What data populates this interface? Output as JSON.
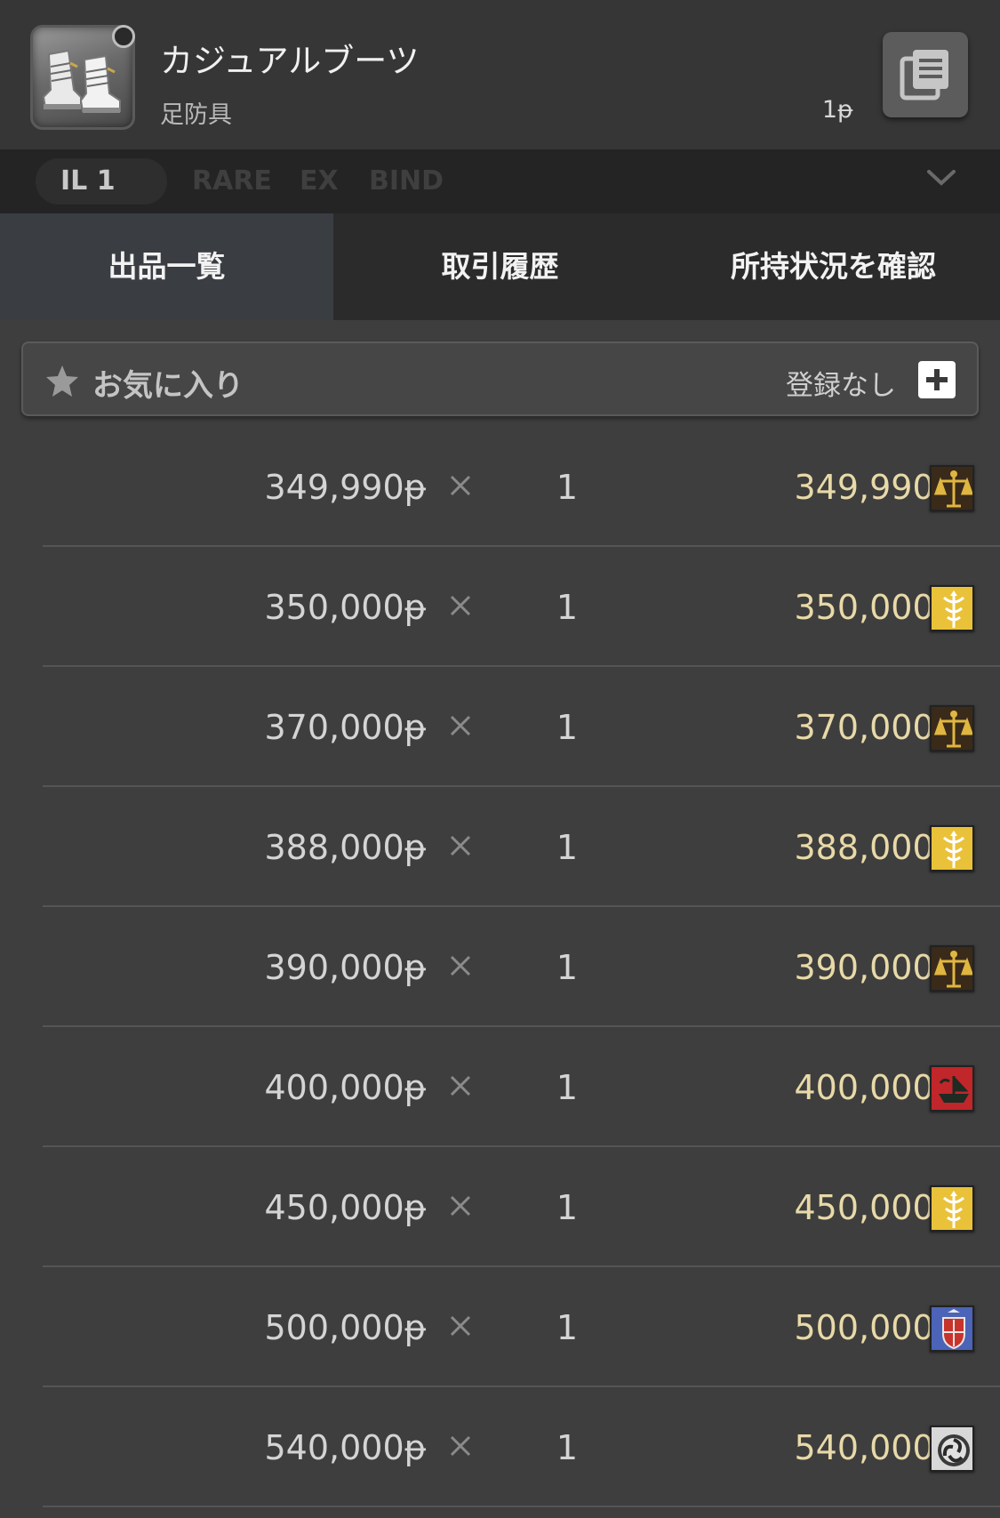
{
  "item": {
    "name": "カジュアルブーツ",
    "category": "足防具",
    "price": "1ᵽ",
    "icon": "boots-icon"
  },
  "attributes": {
    "il": "IL 1",
    "tags": [
      "RARE",
      "EX",
      "BIND"
    ]
  },
  "tabs": [
    {
      "label": "出品一覧",
      "active": true
    },
    {
      "label": "取引履歴",
      "active": false
    },
    {
      "label": "所持状況を確認",
      "active": false
    }
  ],
  "favorite": {
    "label": "お気に入り",
    "status": "登録なし"
  },
  "listings": [
    {
      "unit_price": "349,990ᵽ",
      "qty": "1",
      "total": "349,990ᵽ",
      "crest": "scales-crest"
    },
    {
      "unit_price": "350,000ᵽ",
      "qty": "1",
      "total": "350,000ᵽ",
      "crest": "serpent-crest"
    },
    {
      "unit_price": "370,000ᵽ",
      "qty": "1",
      "total": "370,000ᵽ",
      "crest": "scales-crest"
    },
    {
      "unit_price": "388,000ᵽ",
      "qty": "1",
      "total": "388,000ᵽ",
      "crest": "serpent-crest"
    },
    {
      "unit_price": "390,000ᵽ",
      "qty": "1",
      "total": "390,000ᵽ",
      "crest": "scales-crest"
    },
    {
      "unit_price": "400,000ᵽ",
      "qty": "1",
      "total": "400,000ᵽ",
      "crest": "ship-crest"
    },
    {
      "unit_price": "450,000ᵽ",
      "qty": "1",
      "total": "450,000ᵽ",
      "crest": "serpent-crest"
    },
    {
      "unit_price": "500,000ᵽ",
      "qty": "1",
      "total": "500,000ᵽ",
      "crest": "shield-crest"
    },
    {
      "unit_price": "540,000ᵽ",
      "qty": "1",
      "total": "540,000ᵽ",
      "crest": "swirl-crest"
    }
  ],
  "colors": {
    "background": "#3e3e3e",
    "header": "#363636",
    "active_tab": "#3a3d42",
    "total_price": "#e8d9a8"
  }
}
